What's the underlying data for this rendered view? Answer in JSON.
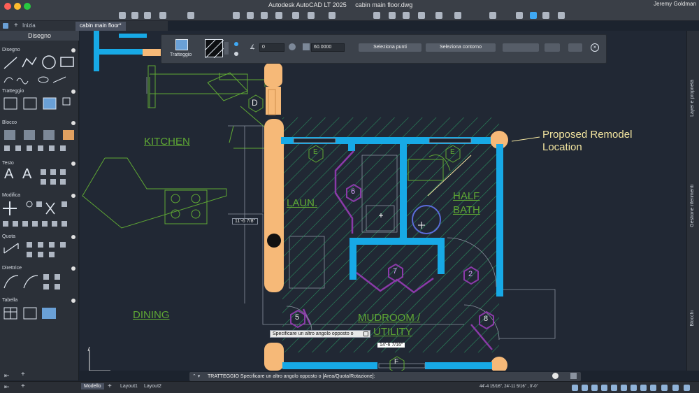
{
  "titlebar": {
    "app_title": "Autodesk AutoCAD LT 2025",
    "file_title": "cabin main floor.dwg",
    "user": "Jeremy Goldman"
  },
  "tabs": {
    "home": "Inizia",
    "file": "cabin main floor*"
  },
  "palette": {
    "title": "Disegno",
    "sections": [
      "Disegno",
      "Tratteggio",
      "Blocco",
      "Testo",
      "Modifica",
      "Quota",
      "Direttrice",
      "Tabella"
    ]
  },
  "hatchbar": {
    "label": "Tratteggio",
    "angle_value": "0",
    "scale_value": "60.0000",
    "pick_points": "Seleziona punti",
    "select_boundary": "Seleziona contorno"
  },
  "annotation": {
    "line1": "Proposed Remodel",
    "line2": "Location",
    "color": "#f4e6a0"
  },
  "rooms": {
    "kitchen": "KITCHEN",
    "laun": "LAUN.",
    "half": "HALF",
    "bath": "BATH",
    "dining": "DINING",
    "mudroom": "MUDROOM /",
    "utility": "UTILITY"
  },
  "tags": {
    "d": "D",
    "e1": "E",
    "e2": "E",
    "six": "6",
    "seven": "7",
    "two": "2",
    "five": "5",
    "eight": "8",
    "f": "F"
  },
  "dimensions": {
    "dim1": "11'-6 7/8\"",
    "dim2": "14'-6 7/16\""
  },
  "tooltip": "Specificare un altro angolo opposto o",
  "command": "TRATTEGGIO Specificare un altro angolo opposto o [Area/Quota/Rotazione]:",
  "right_panels": [
    "Layer e proprietà",
    "Gestione riferimenti",
    "Blocchi"
  ],
  "layout_tabs": [
    "Modello",
    "Layout1",
    "Layout2"
  ],
  "coordinates": "44'-4 15/16\", 24'-11 5/16\" , 0'-0\"",
  "colors": {
    "wall_blue": "#17a9e6",
    "wall_orange": "#f6b978",
    "hatch_green": "#2a8f5e",
    "room_green": "#5fa834",
    "tag_purple": "#8a3aa8"
  }
}
